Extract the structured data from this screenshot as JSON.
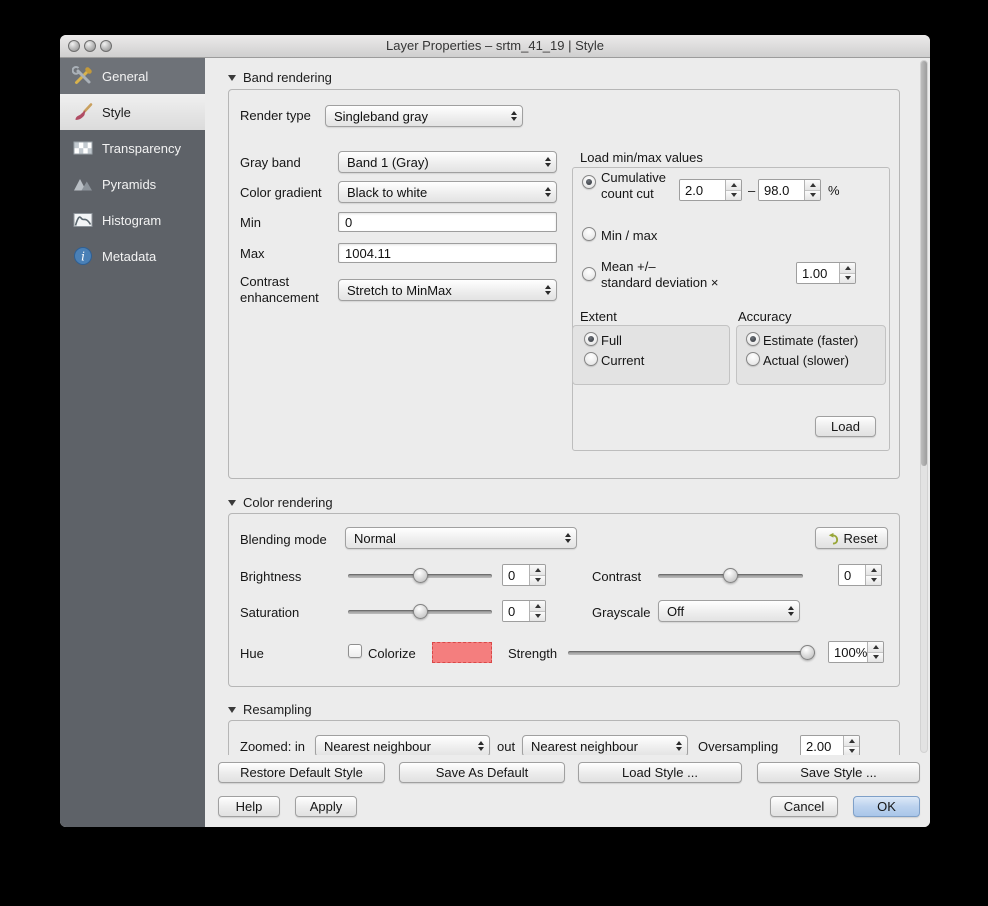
{
  "window": {
    "title": "Layer Properties – srtm_41_19 | Style"
  },
  "sidebar": {
    "items": [
      {
        "label": "General"
      },
      {
        "label": "Style"
      },
      {
        "label": "Transparency"
      },
      {
        "label": "Pyramids"
      },
      {
        "label": "Histogram"
      },
      {
        "label": "Metadata"
      }
    ]
  },
  "band_rendering": {
    "title": "Band rendering",
    "render_type": {
      "label": "Render type",
      "value": "Singleband gray"
    },
    "gray_band": {
      "label": "Gray band",
      "value": "Band 1 (Gray)"
    },
    "color_gradient": {
      "label": "Color gradient",
      "value": "Black to white"
    },
    "min": {
      "label": "Min",
      "value": "0"
    },
    "max": {
      "label": "Max",
      "value": "1004.11"
    },
    "contrast_enhancement": {
      "label_line1": "Contrast",
      "label_line2": "enhancement",
      "value": "Stretch to MinMax"
    },
    "load_minmax": {
      "title": "Load min/max values",
      "cumulative": {
        "label_line1": "Cumulative",
        "label_line2": "count cut",
        "min": "2.0",
        "separator": "–",
        "max": "98.0",
        "unit": "%"
      },
      "minmax_label": "Min / max",
      "mean": {
        "label_line1": "Mean +/–",
        "label_line2": "standard deviation ×",
        "value": "1.00"
      },
      "extent": {
        "title": "Extent",
        "options": [
          {
            "label": "Full"
          },
          {
            "label": "Current"
          }
        ]
      },
      "accuracy": {
        "title": "Accuracy",
        "options": [
          {
            "label": "Estimate (faster)"
          },
          {
            "label": "Actual (slower)"
          }
        ]
      },
      "load_button": "Load"
    }
  },
  "color_rendering": {
    "title": "Color rendering",
    "blending_mode": {
      "label": "Blending mode",
      "value": "Normal"
    },
    "reset_button": "Reset",
    "brightness": {
      "label": "Brightness",
      "value": "0"
    },
    "contrast": {
      "label": "Contrast",
      "value": "0"
    },
    "saturation": {
      "label": "Saturation",
      "value": "0"
    },
    "grayscale": {
      "label": "Grayscale",
      "value": "Off"
    },
    "hue": {
      "label": "Hue",
      "colorize_label": "Colorize",
      "swatch_color": "#f47e7e",
      "strength_label": "Strength",
      "strength_value": "100%"
    }
  },
  "resampling": {
    "title": "Resampling",
    "zoomed_in": {
      "label": "Zoomed: in",
      "value": "Nearest neighbour"
    },
    "zoomed_out": {
      "label": "out",
      "value": "Nearest neighbour"
    },
    "oversampling": {
      "label": "Oversampling",
      "value": "2.00"
    }
  },
  "footer": {
    "restore_default_style": "Restore Default Style",
    "save_as_default": "Save As Default",
    "load_style": "Load Style ...",
    "save_style": "Save Style ...",
    "help": "Help",
    "apply": "Apply",
    "cancel": "Cancel",
    "ok": "OK"
  }
}
